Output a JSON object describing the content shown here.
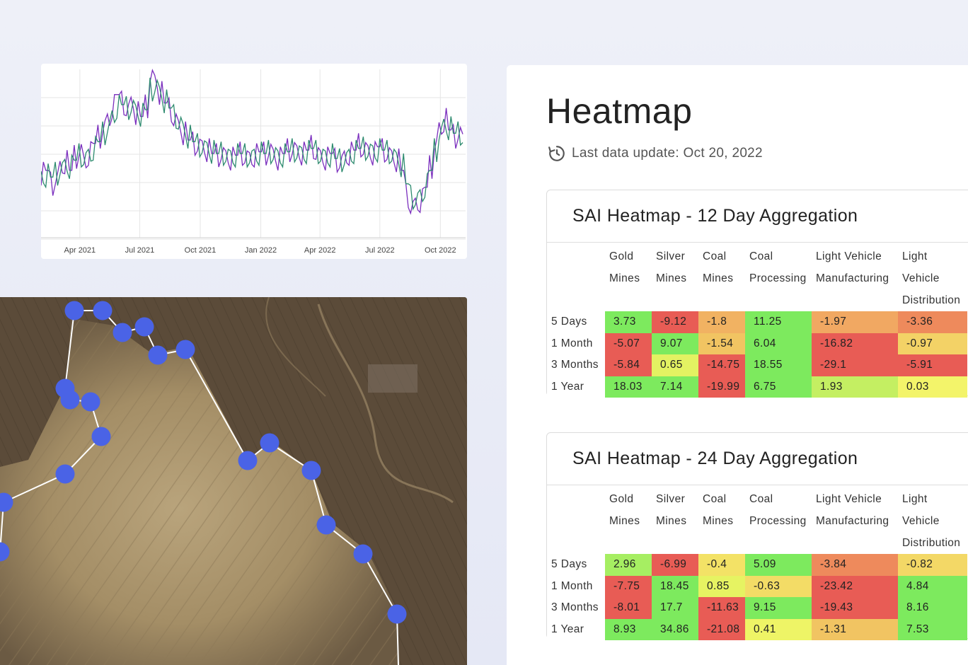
{
  "line_chart": {
    "x_ticks": [
      "Apr 2021",
      "Jul 2021",
      "Oct 2021",
      "Jan 2022",
      "Apr 2022",
      "Jul 2022",
      "Oct 2022"
    ],
    "colors": {
      "series_a": "#7b2fbe",
      "series_b": "#2e8b6f"
    },
    "chart_data": {
      "type": "line",
      "x_start": "2021-02-01",
      "x_end": "2022-10-20",
      "x_tick_labels": [
        "Apr 2021",
        "Jul 2021",
        "Oct 2021",
        "Jan 2022",
        "Apr 2022",
        "Jul 2022",
        "Oct 2022"
      ],
      "ylim": [
        0,
        1
      ],
      "grid": true,
      "series": [
        {
          "values": [
            0.38,
            0.4,
            0.32,
            0.35,
            0.42,
            0.45,
            0.4,
            0.48,
            0.52,
            0.45,
            0.5,
            0.56,
            0.6,
            0.66,
            0.7,
            0.78,
            0.85,
            0.8,
            0.76,
            0.8,
            0.74,
            0.72,
            0.78,
            0.96,
            0.93,
            0.86,
            0.8,
            0.76,
            0.7,
            0.66,
            0.62,
            0.58,
            0.56,
            0.55,
            0.54,
            0.52,
            0.5,
            0.49,
            0.5,
            0.48,
            0.47,
            0.49,
            0.5,
            0.48,
            0.47,
            0.49,
            0.51,
            0.5,
            0.52,
            0.49,
            0.47,
            0.5,
            0.52,
            0.53,
            0.51,
            0.5,
            0.52,
            0.54,
            0.5,
            0.48,
            0.47,
            0.5,
            0.46,
            0.45,
            0.48,
            0.5,
            0.52,
            0.55,
            0.53,
            0.51,
            0.5,
            0.54,
            0.52,
            0.5,
            0.48,
            0.46,
            0.4,
            0.25,
            0.18,
            0.2,
            0.22,
            0.3,
            0.42,
            0.55,
            0.65,
            0.7,
            0.64,
            0.6,
            0.62,
            0.58
          ]
        },
        {
          "values": [
            0.36,
            0.37,
            0.36,
            0.38,
            0.41,
            0.43,
            0.42,
            0.46,
            0.49,
            0.47,
            0.49,
            0.53,
            0.57,
            0.62,
            0.66,
            0.72,
            0.78,
            0.79,
            0.77,
            0.78,
            0.75,
            0.73,
            0.76,
            0.88,
            0.9,
            0.86,
            0.81,
            0.77,
            0.72,
            0.68,
            0.64,
            0.6,
            0.57,
            0.55,
            0.54,
            0.53,
            0.51,
            0.5,
            0.5,
            0.49,
            0.48,
            0.49,
            0.5,
            0.49,
            0.48,
            0.49,
            0.5,
            0.5,
            0.51,
            0.5,
            0.48,
            0.49,
            0.51,
            0.52,
            0.51,
            0.5,
            0.51,
            0.53,
            0.51,
            0.49,
            0.48,
            0.49,
            0.47,
            0.46,
            0.47,
            0.49,
            0.51,
            0.53,
            0.53,
            0.52,
            0.51,
            0.52,
            0.52,
            0.51,
            0.49,
            0.47,
            0.43,
            0.32,
            0.24,
            0.23,
            0.25,
            0.31,
            0.4,
            0.52,
            0.62,
            0.67,
            0.65,
            0.62,
            0.62,
            0.6
          ]
        }
      ]
    }
  },
  "map": {
    "colors": {
      "marker": "#4a63e6",
      "line": "#ffffff"
    }
  },
  "heatmap": {
    "title": "Heatmap",
    "last_update": "Last data update: Oct 20, 2022",
    "colors": {
      "strong_positive": "#7dea5e",
      "mild_positive": "#c4ef62",
      "neutral": "#f3f46a",
      "mild_negative": "#f1b262",
      "negative": "#ee8a5c",
      "strong_negative": "#e85c55"
    },
    "columns": [
      "Gold Mines",
      "Silver Mines",
      "Coal Mines",
      "Coal Processing",
      "Light Vehicle Manufacturing",
      "Light Vehicle Distribution"
    ],
    "tables": [
      {
        "title": "SAI Heatmap - 12 Day Aggregation",
        "rows": [
          {
            "label": "5 Days",
            "values": [
              "3.73",
              "-9.12",
              "-1.8",
              "11.25",
              "-1.97",
              "-3.36"
            ],
            "colors": [
              "#7dea5e",
              "#e85c55",
              "#f1b262",
              "#7dea5e",
              "#f1a862",
              "#ee8a5c"
            ]
          },
          {
            "label": "1 Month",
            "values": [
              "-5.07",
              "9.07",
              "-1.54",
              "6.04",
              "-16.82",
              "-0.97"
            ],
            "colors": [
              "#e85c55",
              "#7dea5e",
              "#f1c462",
              "#7dea5e",
              "#e85c55",
              "#f3d266"
            ]
          },
          {
            "label": "3 Months",
            "values": [
              "-5.84",
              "0.65",
              "-14.75",
              "18.55",
              "-29.1",
              "-5.91"
            ],
            "colors": [
              "#e85c55",
              "#e3f262",
              "#e85c55",
              "#7dea5e",
              "#e85c55",
              "#e85c55"
            ]
          },
          {
            "label": "1 Year",
            "values": [
              "18.03",
              "7.14",
              "-19.99",
              "6.75",
              "1.93",
              "0.03"
            ],
            "colors": [
              "#7dea5e",
              "#7dea5e",
              "#e85c55",
              "#7dea5e",
              "#c4ef62",
              "#f3f46a"
            ]
          }
        ]
      },
      {
        "title": "SAI Heatmap - 24 Day Aggregation",
        "rows": [
          {
            "label": "5 Days",
            "values": [
              "2.96",
              "-6.99",
              "-0.4",
              "5.09",
              "-3.84",
              "-0.82"
            ],
            "colors": [
              "#a6ee62",
              "#e85c55",
              "#f3e266",
              "#7dea5e",
              "#ee8a5c",
              "#f3d866"
            ]
          },
          {
            "label": "1 Month",
            "values": [
              "-7.75",
              "18.45",
              "0.85",
              "-0.63",
              "-23.42",
              "4.84"
            ],
            "colors": [
              "#e85c55",
              "#7dea5e",
              "#e6f362",
              "#f3dc66",
              "#e85c55",
              "#7dea5e"
            ]
          },
          {
            "label": "3 Months",
            "values": [
              "-8.01",
              "17.7",
              "-11.63",
              "9.15",
              "-19.43",
              "8.16"
            ],
            "colors": [
              "#e85c55",
              "#7dea5e",
              "#e85c55",
              "#7dea5e",
              "#e85c55",
              "#7dea5e"
            ]
          },
          {
            "label": "1 Year",
            "values": [
              "8.93",
              "34.86",
              "-21.08",
              "0.41",
              "-1.31",
              "7.53"
            ],
            "colors": [
              "#7dea5e",
              "#7dea5e",
              "#e85c55",
              "#eef466",
              "#f1c462",
              "#7dea5e"
            ]
          }
        ]
      }
    ]
  }
}
